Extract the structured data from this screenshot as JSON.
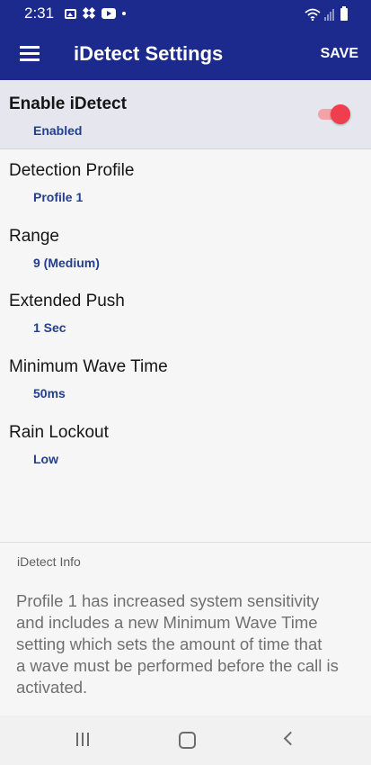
{
  "status_bar": {
    "time": "2:31",
    "icons": [
      "gallery-icon",
      "dropbox-icon",
      "youtube-icon",
      "notification-dot-icon",
      "wifi-icon",
      "signal-icon",
      "battery-icon"
    ]
  },
  "app_bar": {
    "title": "iDetect Settings",
    "save_label": "SAVE",
    "menu_icon": "hamburger-menu-icon",
    "background_color": "#1b2a8c"
  },
  "enable": {
    "title": "Enable iDetect",
    "value": "Enabled",
    "toggle_on": true,
    "toggle_color": "#ef3e4d"
  },
  "settings": [
    {
      "title": "Detection Profile",
      "value": "Profile 1"
    },
    {
      "title": "Range",
      "value": "9 (Medium)"
    },
    {
      "title": "Extended Push",
      "value": "1 Sec"
    },
    {
      "title": "Minimum Wave Time",
      "value": "50ms"
    },
    {
      "title": "Rain Lockout",
      "value": "Low"
    }
  ],
  "info": {
    "label": "iDetect Info",
    "lines": [
      "Profile 1 has increased system sensitivity",
      "and includes a new Minimum Wave Time",
      "setting which sets the amount of time that",
      "a wave must be performed before the call is",
      "activated."
    ]
  },
  "nav_bar": {
    "icons": [
      "recent-apps-icon",
      "home-icon",
      "back-icon"
    ]
  }
}
